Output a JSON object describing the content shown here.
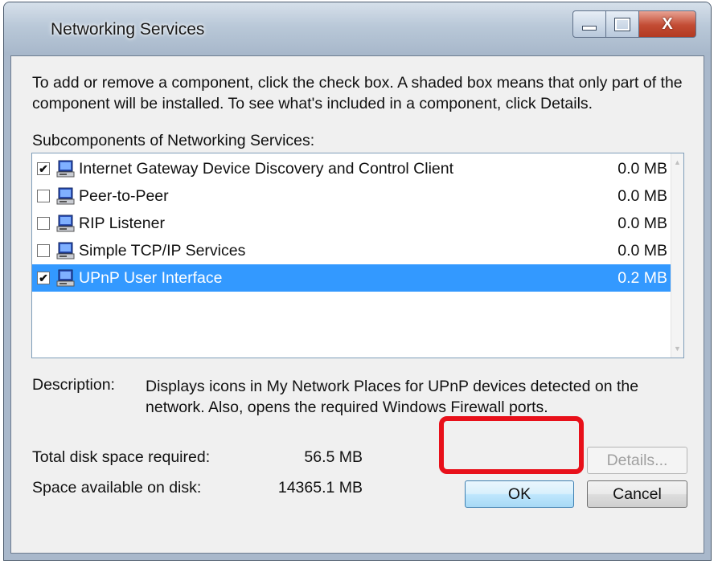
{
  "window": {
    "title": "Networking Services",
    "controls": {
      "minimize_icon": "minimize-icon",
      "maximize_icon": "maximize-icon",
      "close_symbol": "X"
    }
  },
  "intro_text": "To add or remove a component, click the check box. A shaded box means that only part of the component will be installed. To see what's included in a component, click Details.",
  "subcomponents_label": "Subcomponents of Networking Services:",
  "components": [
    {
      "label": "Internet Gateway Device Discovery and Control Client",
      "size": "0.0 MB",
      "checked": true,
      "selected": false
    },
    {
      "label": "Peer-to-Peer",
      "size": "0.0 MB",
      "checked": false,
      "selected": false
    },
    {
      "label": "RIP Listener",
      "size": "0.0 MB",
      "checked": false,
      "selected": false
    },
    {
      "label": "Simple TCP/IP Services",
      "size": "0.0 MB",
      "checked": false,
      "selected": false
    },
    {
      "label": "UPnP User Interface",
      "size": "0.2 MB",
      "checked": true,
      "selected": true
    }
  ],
  "description": {
    "label": "Description:",
    "text": "Displays icons in My Network Places for UPnP devices detected on the network. Also, opens the required Windows Firewall ports."
  },
  "disk": {
    "total_label": "Total disk space required:",
    "total_value": "56.5 MB",
    "available_label": "Space available on disk:",
    "available_value": "14365.1 MB"
  },
  "buttons": {
    "details": "Details...",
    "ok": "OK",
    "cancel": "Cancel"
  },
  "colors": {
    "selection": "#3399ff",
    "highlight_outline": "#e8101a",
    "close_button": "#c24b33"
  }
}
